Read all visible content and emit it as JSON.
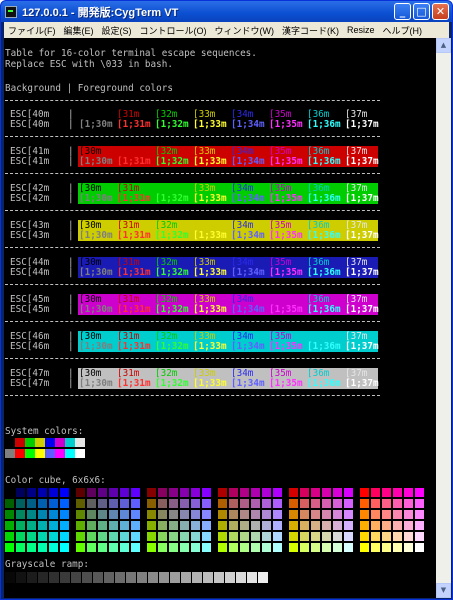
{
  "window": {
    "title": "127.0.0.1 - 開発版:CygTerm VT",
    "minimize": "_",
    "maximize": "□",
    "close": "✕"
  },
  "menu": [
    "ファイル(F)",
    "編集(E)",
    "設定(S)",
    "コントロール(O)",
    "ウィンドウ(W)",
    "漢字コード(K)",
    "Resize",
    "ヘルプ(H)"
  ],
  "terminal": {
    "intro1": "Table for 16-color terminal escape sequences.",
    "intro2": "Replace ESC with \\033 in bash.",
    "header": "Background | Foreground colors",
    "separator": "--------------------------------------------------------------",
    "system_colors_label": "System colors:",
    "color_cube_label": "Color cube, 6x6x6:",
    "grayscale_label": "Grayscale ramp:"
  },
  "table_rows": [
    {
      "label1": "ESC[40m",
      "label2": "ESC[40m",
      "bg": "#000000"
    },
    {
      "label1": "ESC[41m",
      "label2": "ESC[41m",
      "bg": "#cd0000"
    },
    {
      "label1": "ESC[42m",
      "label2": "ESC[42m",
      "bg": "#00cd00"
    },
    {
      "label1": "ESC[43m",
      "label2": "ESC[43m",
      "bg": "#cdcd00"
    },
    {
      "label1": "ESC[44m",
      "label2": "ESC[44m",
      "bg": "#1a1ab4"
    },
    {
      "label1": "ESC[45m",
      "label2": "ESC[45m",
      "bg": "#cd00cd"
    },
    {
      "label1": "ESC[46m",
      "label2": "ESC[46m",
      "bg": "#00cdcd"
    },
    {
      "label1": "ESC[47m",
      "label2": "ESC[47m",
      "bg": "#c0c0c0"
    }
  ],
  "fg_codes_normal": [
    "[30m",
    "[31m",
    "[32m",
    "[33m",
    "[34m",
    "[35m",
    "[36m",
    "[37m"
  ],
  "fg_codes_bold": [
    "[1;30m",
    "[1;31m",
    "[1;32m",
    "[1;33m",
    "[1;34m",
    "[1;35m",
    "[1;36m",
    "[1;37m"
  ],
  "fg_colors_normal": [
    "#000000",
    "#cd0000",
    "#00cd00",
    "#cdcd00",
    "#2a2aee",
    "#cd00cd",
    "#00cdcd",
    "#e5e5e5"
  ],
  "fg_colors_bold": [
    "#7f7f7f",
    "#ff3030",
    "#30ff30",
    "#ffff30",
    "#6060ff",
    "#ff30ff",
    "#30ffff",
    "#ffffff"
  ],
  "system_colors_top": [
    "#000000",
    "#cd0000",
    "#00cd00",
    "#cdcd00",
    "#0000ee",
    "#cd00cd",
    "#00cdcd",
    "#e5e5e5"
  ],
  "system_colors_bottom": [
    "#7f7f7f",
    "#ff0000",
    "#00ff00",
    "#ffff00",
    "#5c5cff",
    "#ff00ff",
    "#00ffff",
    "#ffffff"
  ]
}
